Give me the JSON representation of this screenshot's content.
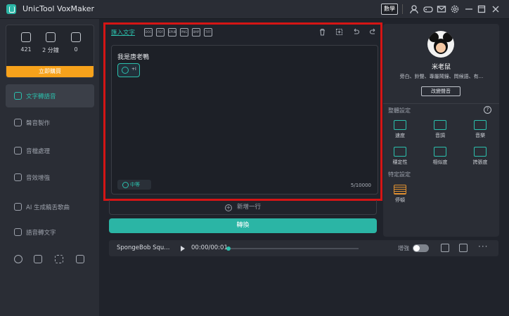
{
  "app": {
    "title": "UnicTool VoxMaker",
    "vip_label": "數學"
  },
  "stats": [
    {
      "icon": "char-count-icon",
      "value": "421"
    },
    {
      "icon": "timer-icon",
      "value": "2 分鐘"
    },
    {
      "icon": "voice-count-icon",
      "value": "0"
    }
  ],
  "buy_label": "立即購買",
  "nav": [
    {
      "label": "文字轉語音",
      "icon": "text-to-speech-icon",
      "active": true
    },
    {
      "label": "聲音製作",
      "icon": "voice-make-icon"
    },
    {
      "label": "音檔處理",
      "icon": "audio-process-icon"
    },
    {
      "label": "音效增強",
      "icon": "audio-enhance-icon"
    },
    {
      "label": "AI 生成饒舌歌曲",
      "icon": "ai-rap-icon"
    },
    {
      "label": "語音轉文字",
      "icon": "speech-to-text-icon"
    }
  ],
  "editor": {
    "import_label": "匯入文字",
    "file_types": [
      "DOC",
      "PDF",
      "EPUB",
      "PNG",
      "BMP",
      "TIFF"
    ],
    "text": "我是唐老鴨",
    "voice_chip_text": "+I",
    "lang_label": "中等",
    "counter": "5/10000"
  },
  "add_line_label": "新增一行",
  "convert_label": "轉換",
  "player": {
    "track": "SpongeBob Squ...",
    "time": "00:00/00:01",
    "enhance_label": "增強",
    "progress": 0.0
  },
  "voice": {
    "name": "米老鼠",
    "description": "旁白、鈴聲、專屬鬧鐘、問候語、有...",
    "change_label": "改變聲音"
  },
  "overall_settings": {
    "title": "整體設定",
    "items": [
      {
        "label": "速度",
        "icon": "speed-icon"
      },
      {
        "label": "音調",
        "icon": "pitch-icon"
      },
      {
        "label": "音樂",
        "icon": "music-icon"
      },
      {
        "label": "穩定性",
        "icon": "stability-icon"
      },
      {
        "label": "相似度",
        "icon": "similarity-icon"
      },
      {
        "label": "誇張度",
        "icon": "exaggeration-icon"
      }
    ]
  },
  "specific_settings": {
    "title": "特定設定",
    "pause_label": "停頓"
  },
  "colors": {
    "accent": "#2bc0ad",
    "buy": "#f7a21b",
    "highlight_border": "#d51515",
    "background": "#20232b"
  }
}
